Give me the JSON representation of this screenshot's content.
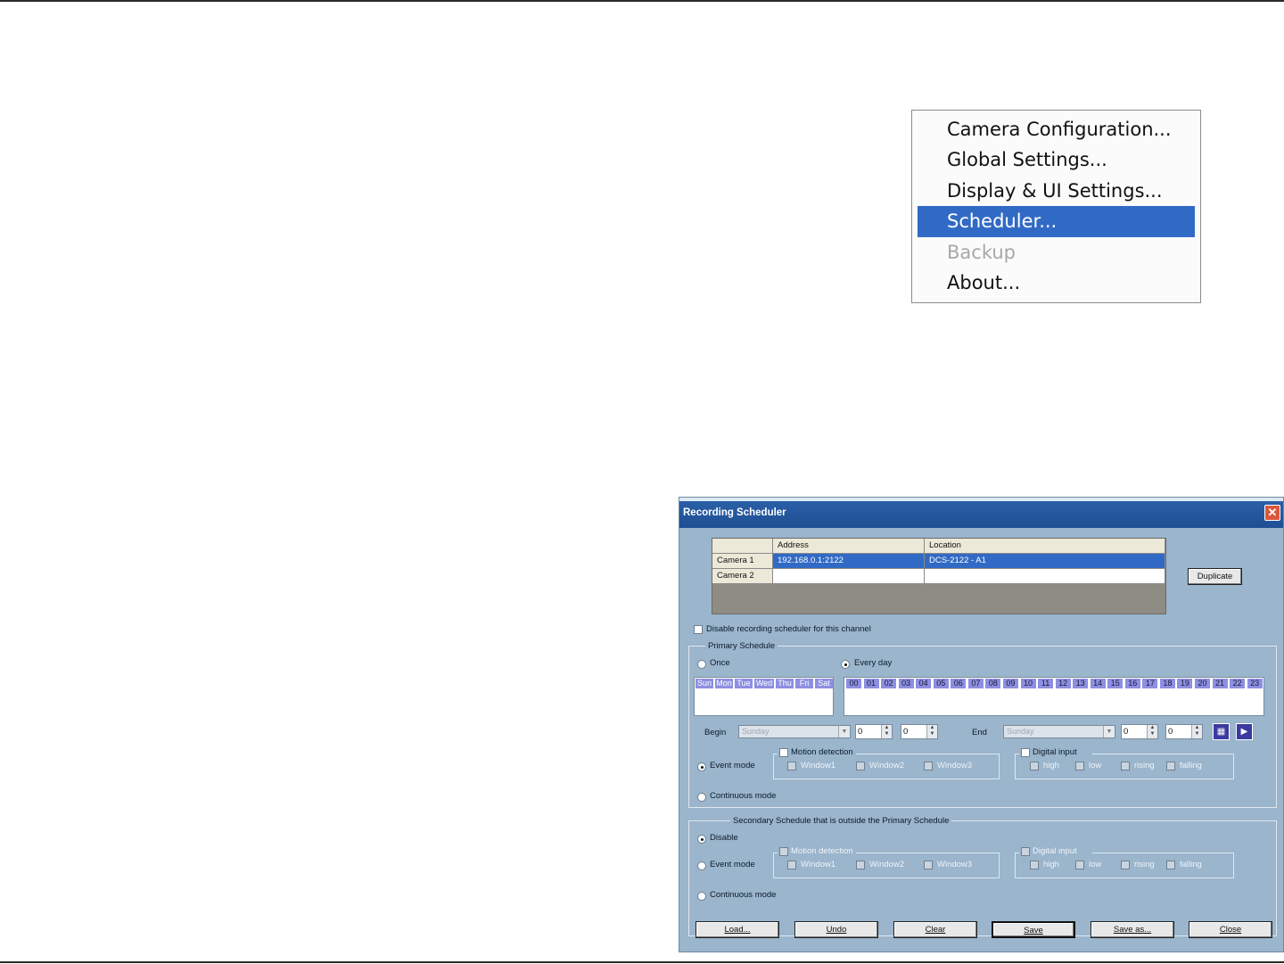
{
  "context_menu": {
    "items": [
      {
        "label": "Camera Configuration..."
      },
      {
        "label": "Global Settings..."
      },
      {
        "label": "Display & UI Settings..."
      },
      {
        "label": "Scheduler..."
      },
      {
        "label": "Backup"
      },
      {
        "label": "About..."
      }
    ],
    "selected_index": 3,
    "disabled_index": 4
  },
  "dialog": {
    "title": "Recording Scheduler",
    "close_glyph": "✕",
    "table": {
      "columns": [
        "Address",
        "Location"
      ],
      "rows": [
        {
          "name": "Camera  1",
          "address": "192.168.0.1:2122",
          "location": "DCS-2122 - A1"
        },
        {
          "name": "Camera  2",
          "address": "",
          "location": ""
        }
      ]
    },
    "duplicate_label": "Duplicate",
    "disable_channel_label": "Disable recording scheduler for this channel",
    "primary": {
      "title": "Primary Schedule",
      "once_label": "Once",
      "everyday_label": "Every day",
      "days": [
        "Sun",
        "Mon",
        "Tue",
        "Wed",
        "Thu",
        "Fri",
        "Sat"
      ],
      "hours": [
        "00",
        "01",
        "02",
        "03",
        "04",
        "05",
        "06",
        "07",
        "08",
        "09",
        "10",
        "11",
        "12",
        "13",
        "14",
        "15",
        "16",
        "17",
        "18",
        "19",
        "20",
        "21",
        "22",
        "23"
      ],
      "begin_label": "Begin",
      "begin_day": "Sunday",
      "begin_hour": "0",
      "begin_min": "0",
      "end_label": "End",
      "end_day": "Sunday",
      "end_hour": "0",
      "end_min": "0",
      "event_mode_label": "Event mode",
      "continuous_mode_label": "Continuous mode",
      "motion_label": "Motion detection",
      "windows": [
        "Window1",
        "Window2",
        "Window3"
      ],
      "digital_label": "Digital input",
      "inputs": [
        "high",
        "low",
        "rising",
        "falling"
      ]
    },
    "secondary": {
      "title": "Secondary Schedule that is outside the Primary Schedule",
      "disable_label": "Disable",
      "event_mode_label": "Event mode",
      "continuous_mode_label": "Continuous mode",
      "motion_label": "Motion detection",
      "windows": [
        "Window1",
        "Window2",
        "Window3"
      ],
      "digital_label": "Digital input",
      "inputs": [
        "high",
        "low",
        "rising",
        "falling"
      ]
    },
    "buttons": [
      "Load...",
      "Undo",
      "Clear",
      "Save",
      "Save as...",
      "Close"
    ]
  }
}
